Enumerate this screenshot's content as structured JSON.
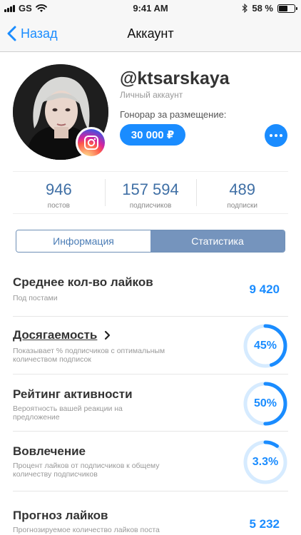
{
  "status_bar": {
    "carrier": "GS",
    "time": "9:41 AM",
    "battery": "58 %",
    "battery_level": 0.58
  },
  "nav": {
    "back_label": "Назад",
    "title": "Аккаунт"
  },
  "profile": {
    "username": "@ktsarskaya",
    "account_type": "Личный аккаунт",
    "fee_label": "Гонорар за размещение:",
    "fee_value": "30 000 ₽"
  },
  "stats": [
    {
      "value": "946",
      "label": "постов"
    },
    {
      "value": "157 594",
      "label": "подписчиков"
    },
    {
      "value": "489",
      "label": "подписки"
    }
  ],
  "tabs": [
    {
      "label": "Информация",
      "active": false
    },
    {
      "label": "Статистика",
      "active": true
    }
  ],
  "metrics": [
    {
      "title": "Среднее кол-во лайков",
      "desc": "Под постами",
      "value": "9 420"
    },
    {
      "title": "Досягаемость",
      "desc": "Показывает % подписчиков с оптимальным количеством подписок",
      "value": "45%",
      "fraction": 0.45
    },
    {
      "title": "Рейтинг активности",
      "desc": "Вероятность вашей реакции на предложение",
      "value": "50%",
      "fraction": 0.5
    },
    {
      "title": "Вовлечение",
      "desc": "Процент лайков от подписчиков к общему количеству подписчиков",
      "value": "3.3%",
      "fraction": 0.1
    },
    {
      "title": "Прогноз лайков",
      "desc": "Прогнозируемое количество лайков поста",
      "value": "5 232"
    }
  ],
  "colors": {
    "accent": "#1a8cff",
    "ring_track": "#d6ebff",
    "segment_active": "#7594bd"
  },
  "icons": {
    "back": "chevron-left-icon",
    "insta": "instagram-icon",
    "more": "more-dots-icon",
    "link": "chevron-right-icon"
  }
}
